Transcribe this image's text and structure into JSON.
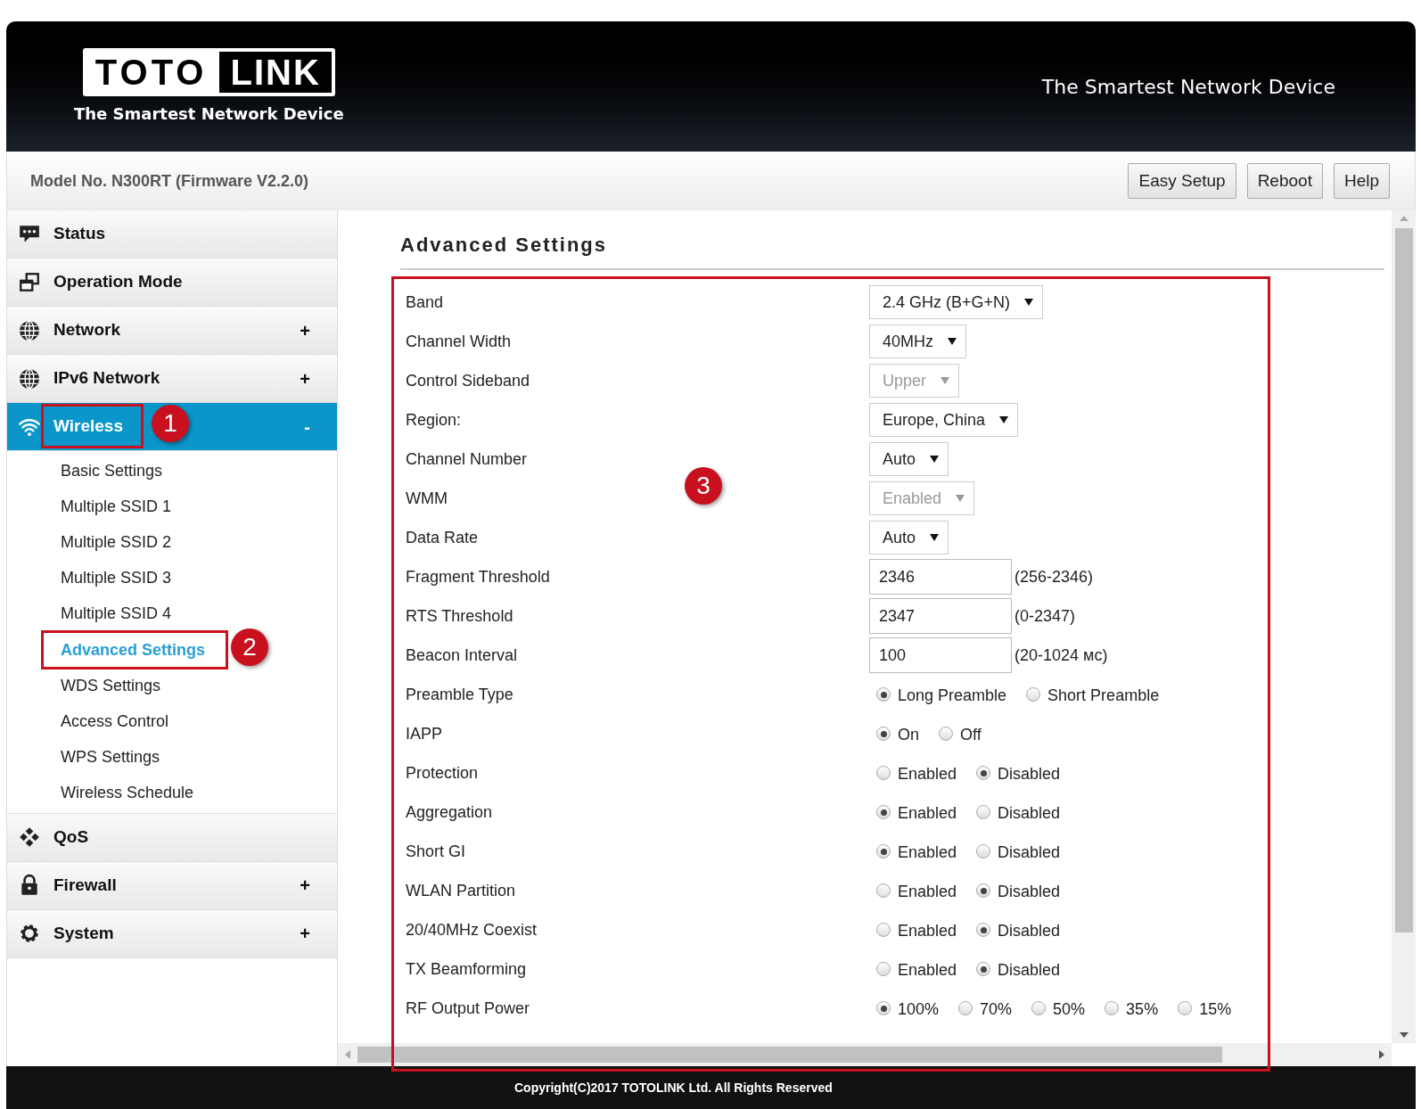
{
  "header": {
    "logo": {
      "left": "TOTO",
      "right": "LINK"
    },
    "logo_tagline": "The Smartest Network Device",
    "slogan": "The Smartest Network Device"
  },
  "model_bar": {
    "model": "Model No. N300RT (Firmware V2.2.0)",
    "buttons": [
      "Easy Setup",
      "Reboot",
      "Help"
    ]
  },
  "sidebar": {
    "items": [
      {
        "label": "Status",
        "selected": false
      },
      {
        "label": "Operation Mode",
        "selected": false
      },
      {
        "label": "Network",
        "sign": "+",
        "selected": false
      },
      {
        "label": "IPv6 Network",
        "sign": "+",
        "selected": false
      },
      {
        "label": "Wireless",
        "sign": "-",
        "selected": true,
        "expanded": true,
        "children": [
          {
            "label": "Basic Settings",
            "selected": false
          },
          {
            "label": "Multiple SSID 1",
            "selected": false
          },
          {
            "label": "Multiple SSID 2",
            "selected": false
          },
          {
            "label": "Multiple SSID 3",
            "selected": false
          },
          {
            "label": "Multiple SSID 4",
            "selected": false
          },
          {
            "label": "Advanced Settings",
            "selected": true
          },
          {
            "label": "WDS Settings",
            "selected": false
          },
          {
            "label": "Access Control",
            "selected": false
          },
          {
            "label": "WPS Settings",
            "selected": false
          },
          {
            "label": "Wireless Schedule",
            "selected": false
          }
        ]
      },
      {
        "label": "QoS",
        "selected": false
      },
      {
        "label": "Firewall",
        "sign": "+",
        "selected": false
      },
      {
        "label": "System",
        "sign": "+",
        "selected": false
      }
    ]
  },
  "content": {
    "title": "Advanced Settings",
    "fields": [
      {
        "kind": "select",
        "label": "Band",
        "value": "2.4 GHz (B+G+N)",
        "disabled": false
      },
      {
        "kind": "select",
        "label": "Channel Width",
        "value": "40MHz",
        "disabled": false
      },
      {
        "kind": "select",
        "label": "Control Sideband",
        "value": "Upper",
        "disabled": true
      },
      {
        "kind": "select",
        "label": "Region:",
        "value": "Europe, China",
        "disabled": false
      },
      {
        "kind": "select",
        "label": "Channel Number",
        "value": "Auto",
        "disabled": false
      },
      {
        "kind": "select",
        "label": "WMM",
        "value": "Enabled",
        "disabled": true
      },
      {
        "kind": "select",
        "label": "Data Rate",
        "value": "Auto",
        "disabled": false
      },
      {
        "kind": "text",
        "label": "Fragment Threshold",
        "value": "2346",
        "hint": "(256-2346)"
      },
      {
        "kind": "text",
        "label": "RTS Threshold",
        "value": "2347",
        "hint": "(0-2347)"
      },
      {
        "kind": "text",
        "label": "Beacon Interval",
        "value": "100",
        "hint": "(20-1024 мс)"
      },
      {
        "kind": "radio",
        "label": "Preamble Type",
        "options": [
          {
            "label": "Long Preamble",
            "selected": true
          },
          {
            "label": "Short Preamble",
            "selected": false
          }
        ]
      },
      {
        "kind": "radio",
        "label": "IAPP",
        "options": [
          {
            "label": "On",
            "selected": true
          },
          {
            "label": "Off",
            "selected": false
          }
        ]
      },
      {
        "kind": "radio",
        "label": "Protection",
        "options": [
          {
            "label": "Enabled",
            "selected": false
          },
          {
            "label": "Disabled",
            "selected": true
          }
        ]
      },
      {
        "kind": "radio",
        "label": "Aggregation",
        "options": [
          {
            "label": "Enabled",
            "selected": true
          },
          {
            "label": "Disabled",
            "selected": false
          }
        ]
      },
      {
        "kind": "radio",
        "label": "Short GI",
        "options": [
          {
            "label": "Enabled",
            "selected": true
          },
          {
            "label": "Disabled",
            "selected": false
          }
        ]
      },
      {
        "kind": "radio",
        "label": "WLAN Partition",
        "options": [
          {
            "label": "Enabled",
            "selected": false
          },
          {
            "label": "Disabled",
            "selected": true
          }
        ]
      },
      {
        "kind": "radio",
        "label": "20/40MHz Coexist",
        "options": [
          {
            "label": "Enabled",
            "selected": false
          },
          {
            "label": "Disabled",
            "selected": true
          }
        ]
      },
      {
        "kind": "radio",
        "label": "TX Beamforming",
        "options": [
          {
            "label": "Enabled",
            "selected": false
          },
          {
            "label": "Disabled",
            "selected": true
          }
        ]
      },
      {
        "kind": "radio",
        "label": "RF Output Power",
        "options": [
          {
            "label": "100%",
            "selected": true
          },
          {
            "label": "70%",
            "selected": false
          },
          {
            "label": "50%",
            "selected": false
          },
          {
            "label": "35%",
            "selected": false
          },
          {
            "label": "15%",
            "selected": false
          }
        ]
      }
    ]
  },
  "annotations": [
    {
      "label": "1"
    },
    {
      "label": "2"
    },
    {
      "label": "3"
    }
  ],
  "footer": {
    "copyright": "Copyright(C)2017 TOTOLINK Ltd. All Rights Reserved"
  }
}
